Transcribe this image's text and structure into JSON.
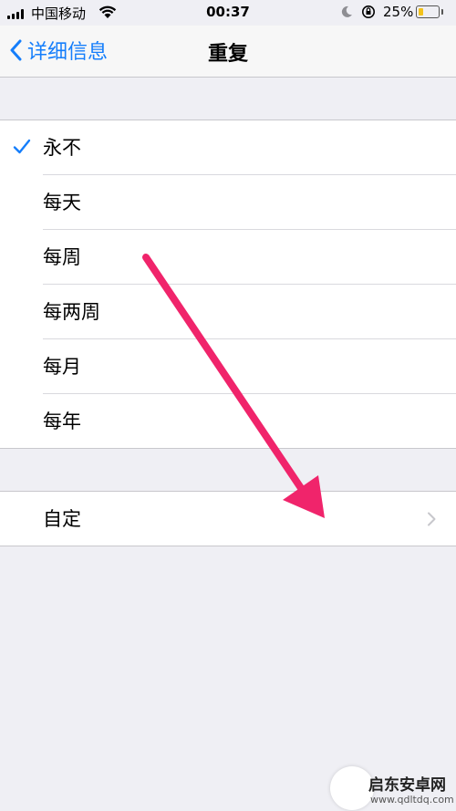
{
  "status_bar": {
    "carrier": "中国移动",
    "time": "00:37",
    "battery_percent": "25%",
    "battery_level": 0.25,
    "icons": [
      "signal-icon",
      "wifi-icon",
      "moon-icon",
      "orientation-lock-icon",
      "battery-icon"
    ]
  },
  "nav": {
    "back_label": "详细信息",
    "title": "重复"
  },
  "options": [
    {
      "label": "永不",
      "selected": true
    },
    {
      "label": "每天",
      "selected": false
    },
    {
      "label": "每周",
      "selected": false
    },
    {
      "label": "每两周",
      "selected": false
    },
    {
      "label": "每月",
      "selected": false
    },
    {
      "label": "每年",
      "selected": false
    }
  ],
  "custom": {
    "label": "自定"
  },
  "colors": {
    "accent": "#157efb",
    "background": "#efeff4",
    "annotation_arrow": "#f0246b"
  },
  "watermark": {
    "text": "启东安卓网",
    "url": "www.qdltdq.com"
  }
}
